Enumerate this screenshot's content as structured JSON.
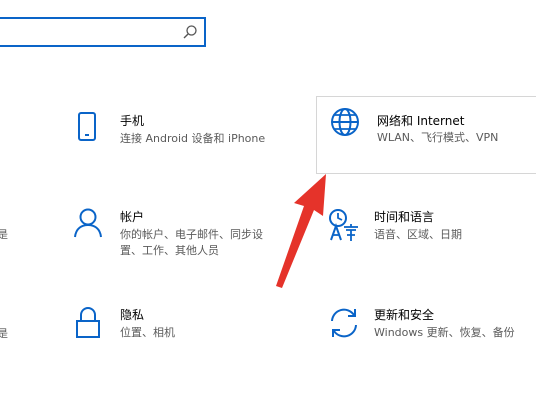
{
  "search": {
    "placeholder": "",
    "icon": "search-icon"
  },
  "tiles": {
    "phone": {
      "title": "手机",
      "desc": "连接 Android 设备和 iPhone",
      "icon": "phone-icon"
    },
    "network": {
      "title": "网络和 Internet",
      "desc": "WLAN、飞行模式、VPN",
      "icon": "globe-icon"
    },
    "accounts": {
      "title": "帐户",
      "desc_line1": "你的帐户、电子邮件、同步设",
      "desc_line2": "置、工作、其他人员",
      "icon": "person-icon"
    },
    "time": {
      "title": "时间和语言",
      "desc": "语音、区域、日期",
      "icon": "time-language-icon"
    },
    "privacy": {
      "title": "隐私",
      "desc": "位置、相机",
      "icon": "lock-icon"
    },
    "update": {
      "title": "更新和安全",
      "desc": "Windows 更新、恢复、备份",
      "icon": "sync-icon"
    }
  },
  "edge_fragments": {
    "a": "是",
    "b": "是"
  },
  "colors": {
    "accent": "#0a64c8",
    "arrow": "#e5332a",
    "desc_text": "#5a5a5a"
  }
}
